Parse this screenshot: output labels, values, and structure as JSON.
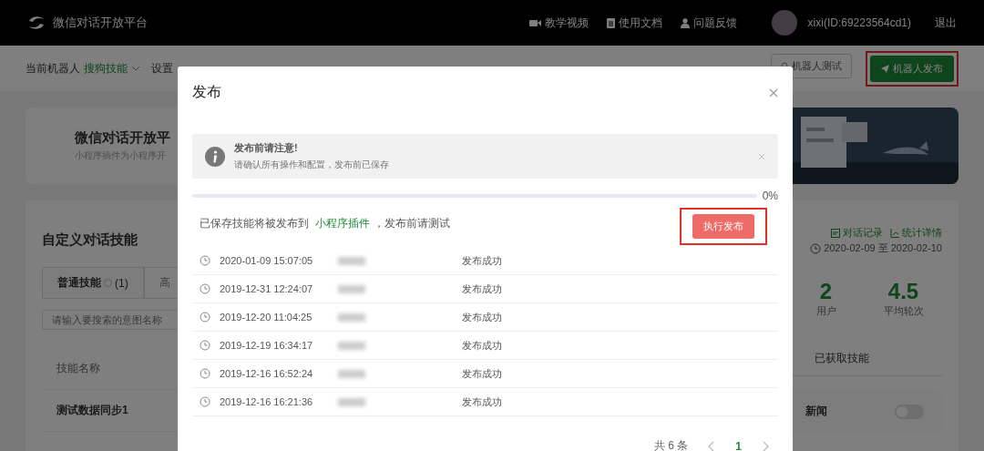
{
  "topbar": {
    "logo_text": "微信对话开放平台",
    "links": [
      {
        "label": "教学视频",
        "kind": "video"
      },
      {
        "label": "使用文档",
        "kind": "doc"
      },
      {
        "label": "问题反馈",
        "kind": "user"
      }
    ],
    "user": "xixi(ID:69223564cd1)",
    "logout": "退出"
  },
  "subheader": {
    "label": "当前机器人",
    "bot": "搜狗技能",
    "settings": "设置",
    "buttons": [
      {
        "label": "机器人测试",
        "kind": "outline",
        "highlighted": false
      },
      {
        "label": "机器人发布",
        "kind": "primary",
        "highlighted": true
      }
    ]
  },
  "banner": {
    "title": "微信对话开放平",
    "subtitle": "小程序插件为小程序开"
  },
  "skills": {
    "title": "自定义对话技能",
    "tabs": [
      {
        "label": "普通技能",
        "count": "(1)",
        "selected": true
      },
      {
        "label": "高",
        "selected": false
      }
    ],
    "search": {
      "placeholder": "请输入要搜索的意图名称"
    },
    "columns": [
      "技能名称"
    ],
    "rows": [
      "测试数据同步1"
    ]
  },
  "stats": {
    "links": [
      {
        "label": "对话记录",
        "kind": "chat"
      },
      {
        "label": "统计详情",
        "kind": "chart"
      }
    ],
    "date_range": "2020-02-09 至 2020-02-10",
    "metrics": [
      {
        "value": "2",
        "label": "用户"
      },
      {
        "value": "4.5",
        "label": "平均轮次"
      }
    ],
    "tab": "已获取技能",
    "cards": [
      {
        "name": "新闻",
        "on": false
      }
    ]
  },
  "modal": {
    "title": "发布",
    "alert": {
      "title": "发布前请注意!",
      "text": "请确认所有操作和配置，发布前已保存"
    },
    "progress": {
      "level": 0,
      "reading": "0%"
    },
    "note": {
      "before": "已保存技能将被发布到",
      "link": "小程序插件",
      "after": "，发布前请测试"
    },
    "action": {
      "label": "执行发布",
      "highlighted": true
    },
    "rows": [
      {
        "time": "2020-01-09 15:07:05",
        "status": "发布成功"
      },
      {
        "time": "2019-12-31 12:24:07",
        "status": "发布成功"
      },
      {
        "time": "2019-12-20 11:04:25",
        "status": "发布成功"
      },
      {
        "time": "2019-12-19 16:34:17",
        "status": "发布成功"
      },
      {
        "time": "2019-12-16 16:52:24",
        "status": "发布成功"
      },
      {
        "time": "2019-12-16 16:21:36",
        "status": "发布成功"
      }
    ],
    "pagination": {
      "total": "共 6 条",
      "pages": [
        {
          "label": "1",
          "selected": true
        }
      ]
    }
  }
}
